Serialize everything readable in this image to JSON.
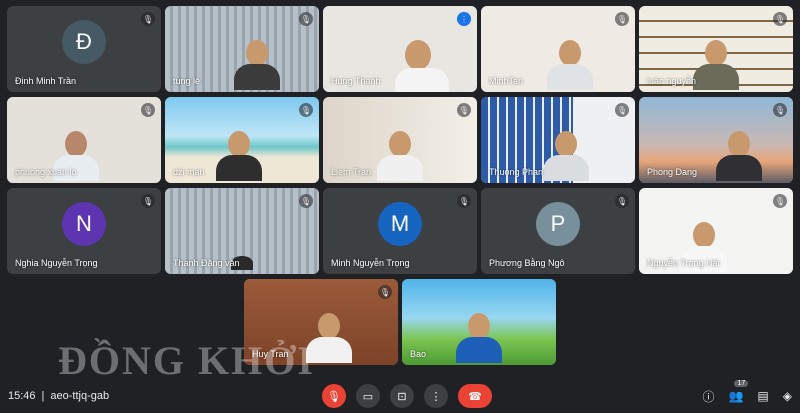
{
  "watermark": "ĐỒNG KHỞI",
  "meeting": {
    "time": "15:46",
    "separator": "|",
    "code": "aeo-ttjq-gab"
  },
  "participants_row1": [
    {
      "name": "Đinh Minh Trần",
      "initial": "Đ",
      "avatar_color": "#455a64"
    },
    {
      "name": "tung lê"
    },
    {
      "name": "Hung Thanh"
    },
    {
      "name": "MinhTan"
    },
    {
      "name": "luân nguyễn"
    }
  ],
  "participants_row2": [
    {
      "name": "phuong xuan lo"
    },
    {
      "name": "dzi man"
    },
    {
      "name": "Liem Tran"
    },
    {
      "name": "Thuong Phan"
    },
    {
      "name": "Phong Dang"
    }
  ],
  "participants_row3": [
    {
      "name": "Nghia Nguyễn Trọng",
      "initial": "N",
      "avatar_color": "#5e35b1"
    },
    {
      "name": "Thanh Đặng văn"
    },
    {
      "name": "Minh Nguyễn Trọng",
      "initial": "M",
      "avatar_color": "#1565c0"
    },
    {
      "name": "Phương Bằng Ngô",
      "initial": "P",
      "avatar_color": "#78909c"
    },
    {
      "name": "Nguyễn Trọng Hải"
    }
  ],
  "participants_row4": [
    {
      "name": "Huy Tran"
    },
    {
      "name": "Bao"
    }
  ],
  "people_count": "17",
  "colors": {
    "background": "#202124",
    "tile": "#3c4043",
    "end_call": "#ea4335",
    "speaking": "#4285f4"
  }
}
